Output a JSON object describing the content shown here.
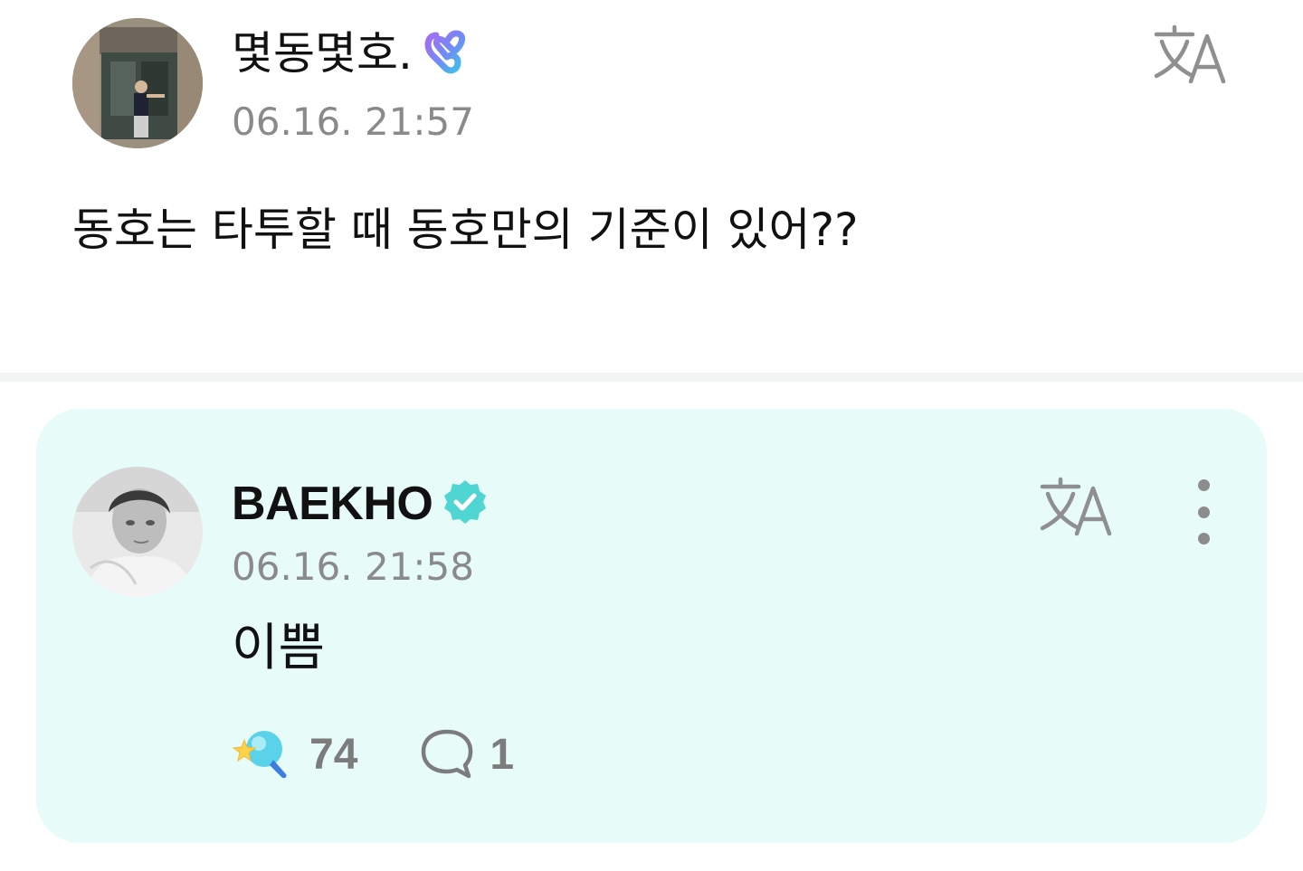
{
  "post": {
    "author": "몇동몇호.",
    "timestamp": "06.16. 21:57",
    "body": "동호는 타투할 때 동호만의 기준이 있어??",
    "icons": {
      "badge": "weverse-heart-badge-icon",
      "translate": "translate-icon"
    }
  },
  "reply": {
    "author": "BAEKHO",
    "timestamp": "06.16. 21:58",
    "body": "이쁨",
    "like_count": "74",
    "comment_count": "1",
    "icons": {
      "verified": "verified-badge-icon",
      "translate": "translate-icon",
      "more": "more-vertical-icon",
      "like": "cheer-lightstick-icon",
      "comment": "speech-bubble-icon"
    }
  },
  "colors": {
    "card_bg": "#e7fcf8",
    "verified": "#4fd6d3",
    "timestamp": "#8a8a8a",
    "divider": "#f3f4f4"
  }
}
